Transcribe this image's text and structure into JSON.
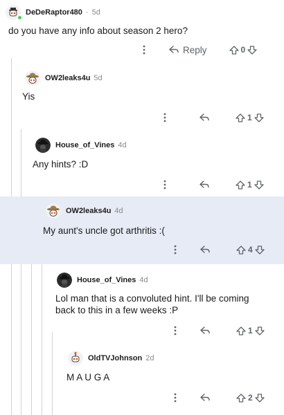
{
  "comments": [
    {
      "username": "DeDeRaptor480",
      "separator": "·",
      "age": "5d",
      "text": "do you have any info about season 2 hero?",
      "reply_label": "Reply",
      "votes": "0",
      "avatar": "robot-avatar-icon"
    },
    {
      "username": "OW2leaks4u",
      "age": "5d",
      "text": "Yis",
      "votes": "1",
      "avatar": "cowboy-hat-avatar-icon"
    },
    {
      "username": "House_of_Vines",
      "age": "4d",
      "text": "Any hints? :D",
      "votes": "1",
      "avatar": "dark-hat-avatar-icon"
    },
    {
      "username": "OW2leaks4u",
      "age": "4d",
      "text": "My aunt's uncle got arthritis :(",
      "votes": "4",
      "avatar": "cowboy-hat-avatar-icon"
    },
    {
      "username": "House_of_Vines",
      "age": "4d",
      "text_line1": "Lol man that is a convoluted hint. I'll be coming",
      "text_line2": "back to this in a few weeks :P",
      "votes": "1",
      "avatar": "dark-hat-avatar-icon"
    },
    {
      "username": "OldTVJohnson",
      "age": "2d",
      "text": "M A U G A",
      "votes": "2",
      "avatar": "robot-avatar-icon"
    }
  ],
  "colors": {
    "highlight": "#e6ebf5",
    "thread_line": "#cfd3d8",
    "online": "#46d160"
  }
}
